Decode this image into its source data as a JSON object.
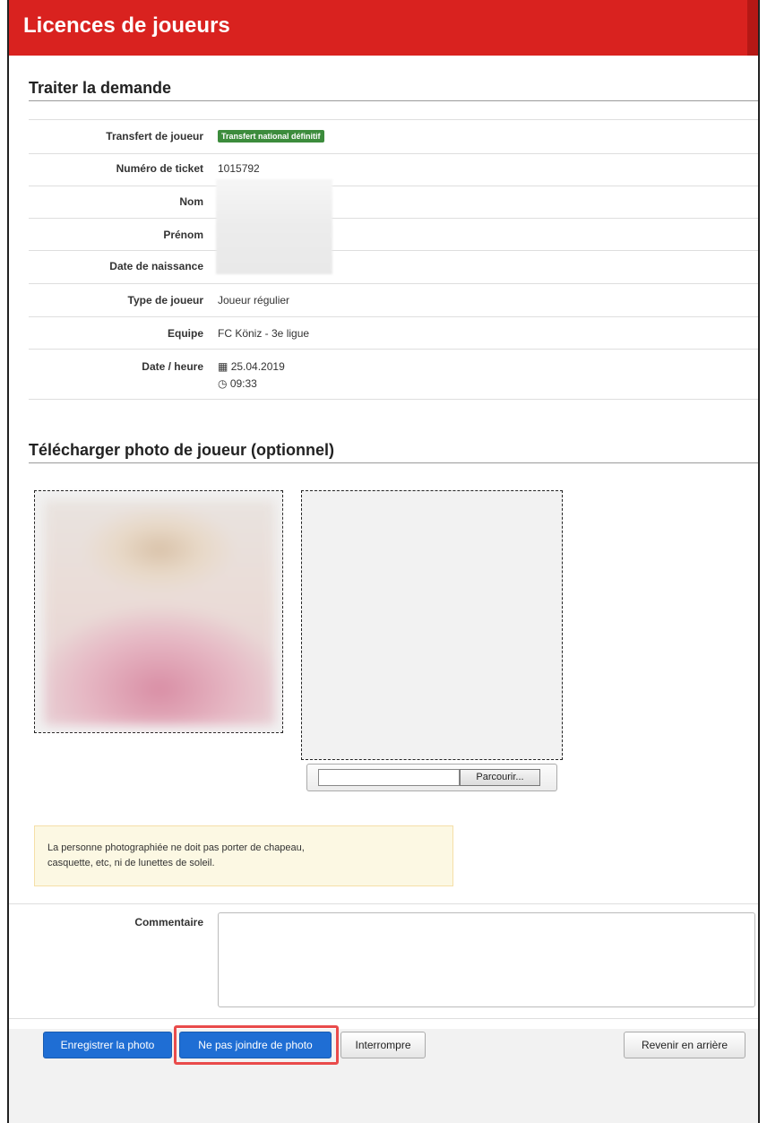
{
  "header": {
    "title": "Licences de joueurs"
  },
  "section1": {
    "title": "Traiter la demande",
    "rows": [
      {
        "label": "Transfert de joueur",
        "badge": "Transfert national définitif"
      },
      {
        "label": "Numéro de ticket",
        "value": "1015792"
      },
      {
        "label": "Nom",
        "value": ""
      },
      {
        "label": "Prénom",
        "value": ""
      },
      {
        "label": "Date de naissance",
        "value": ""
      },
      {
        "label": "Type de joueur",
        "value": "Joueur régulier"
      },
      {
        "label": "Equipe",
        "value": "FC Köniz - 3e ligue"
      },
      {
        "label": "Date / heure",
        "date": "25.04.2019",
        "time": "09:33"
      }
    ]
  },
  "section2": {
    "title": "Télécharger photo de joueur (optionnel)",
    "browse_label": "Parcourir...",
    "notice_line1": "La personne photographiée ne doit pas porter de chapeau,",
    "notice_line2": "casquette, etc, ni de lunettes de soleil.",
    "comment_label": "Commentaire"
  },
  "footer": {
    "save": "Enregistrer la photo",
    "skip": "Ne pas joindre de photo",
    "cancel": "Interrompre",
    "back": "Revenir en arrière"
  },
  "colors": {
    "header": "#d9221f",
    "badge": "#3c8c3c",
    "primary": "#1f6ed4",
    "highlight": "#e94b4b"
  }
}
